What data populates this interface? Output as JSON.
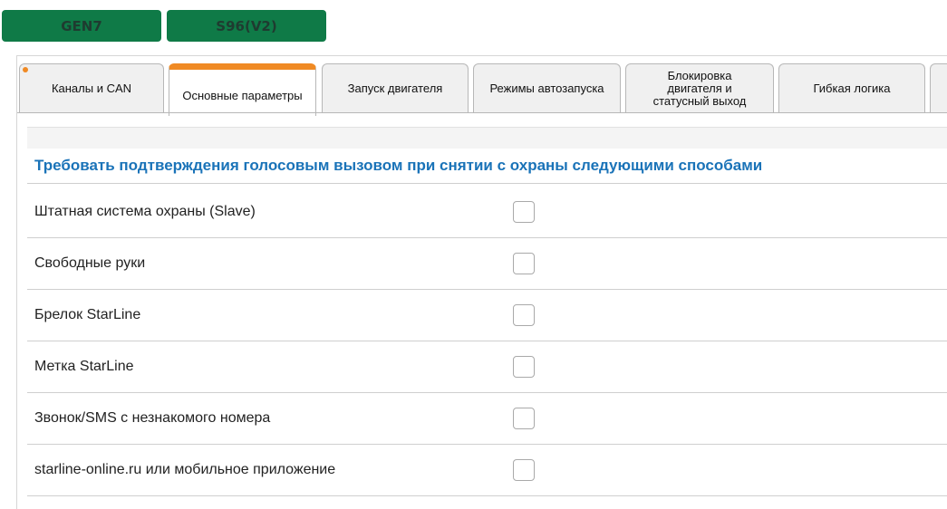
{
  "top_buttons": {
    "gen7": "GEN7",
    "s96": "S96(V2)"
  },
  "tabs": [
    {
      "label": "Каналы и CAN"
    },
    {
      "label": "Основные параметры"
    },
    {
      "label": "Запуск двигателя"
    },
    {
      "label": "Режимы автозапуска"
    },
    {
      "label": "Блокировка двигателя и статусный выход"
    },
    {
      "label": "Гибкая логика"
    }
  ],
  "section": {
    "title": "Требовать подтверждения голосовым вызовом при снятии с охраны следующими способами"
  },
  "rows": [
    {
      "label": "Штатная система охраны (Slave)",
      "checked": false
    },
    {
      "label": "Свободные руки",
      "checked": false
    },
    {
      "label": "Брелок StarLine",
      "checked": false
    },
    {
      "label": "Метка StarLine",
      "checked": false
    },
    {
      "label": "Звонок/SMS с незнакомого номера",
      "checked": false
    },
    {
      "label": "starline-online.ru или мобильное приложение",
      "checked": false
    }
  ],
  "colors": {
    "top_button_bg": "#0f7a47",
    "active_tab_accent": "#f08a24",
    "section_title": "#1a73b8"
  }
}
